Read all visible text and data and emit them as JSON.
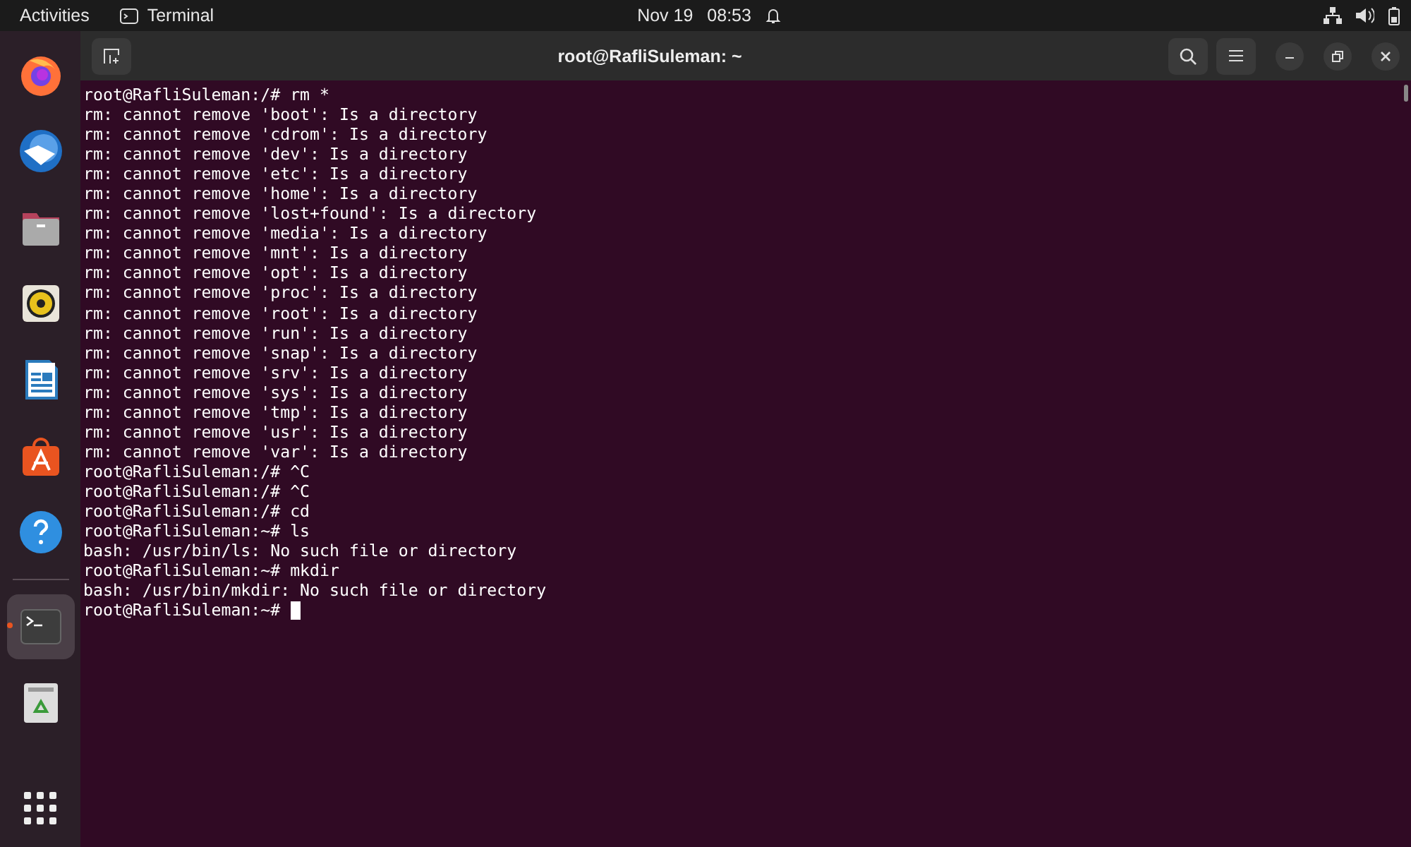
{
  "top_bar": {
    "activities": "Activities",
    "app_menu": "Terminal",
    "date": "Nov 19",
    "time": "08:53"
  },
  "dock": {
    "items": [
      {
        "kind": "firefox",
        "running": false
      },
      {
        "kind": "mail",
        "running": false
      },
      {
        "kind": "files",
        "running": false
      },
      {
        "kind": "music",
        "running": false
      },
      {
        "kind": "writer",
        "running": false
      },
      {
        "kind": "store",
        "running": false
      },
      {
        "kind": "help",
        "running": false
      },
      {
        "kind": "separator"
      },
      {
        "kind": "terminal",
        "running": true
      },
      {
        "kind": "trash",
        "running": false
      }
    ]
  },
  "window": {
    "title": "root@RafliSuleman: ~"
  },
  "terminal": {
    "lines": [
      "root@RafliSuleman:/# rm *",
      "rm: cannot remove 'boot': Is a directory",
      "rm: cannot remove 'cdrom': Is a directory",
      "rm: cannot remove 'dev': Is a directory",
      "rm: cannot remove 'etc': Is a directory",
      "rm: cannot remove 'home': Is a directory",
      "rm: cannot remove 'lost+found': Is a directory",
      "rm: cannot remove 'media': Is a directory",
      "rm: cannot remove 'mnt': Is a directory",
      "rm: cannot remove 'opt': Is a directory",
      "rm: cannot remove 'proc': Is a directory",
      "rm: cannot remove 'root': Is a directory",
      "rm: cannot remove 'run': Is a directory",
      "rm: cannot remove 'snap': Is a directory",
      "rm: cannot remove 'srv': Is a directory",
      "rm: cannot remove 'sys': Is a directory",
      "rm: cannot remove 'tmp': Is a directory",
      "rm: cannot remove 'usr': Is a directory",
      "rm: cannot remove 'var': Is a directory",
      "root@RafliSuleman:/# ^C",
      "root@RafliSuleman:/# ^C",
      "root@RafliSuleman:/# cd",
      "root@RafliSuleman:~# ls",
      "bash: /usr/bin/ls: No such file or directory",
      "root@RafliSuleman:~# mkdir",
      "bash: /usr/bin/mkdir: No such file or directory"
    ],
    "prompt": "root@RafliSuleman:~#"
  }
}
